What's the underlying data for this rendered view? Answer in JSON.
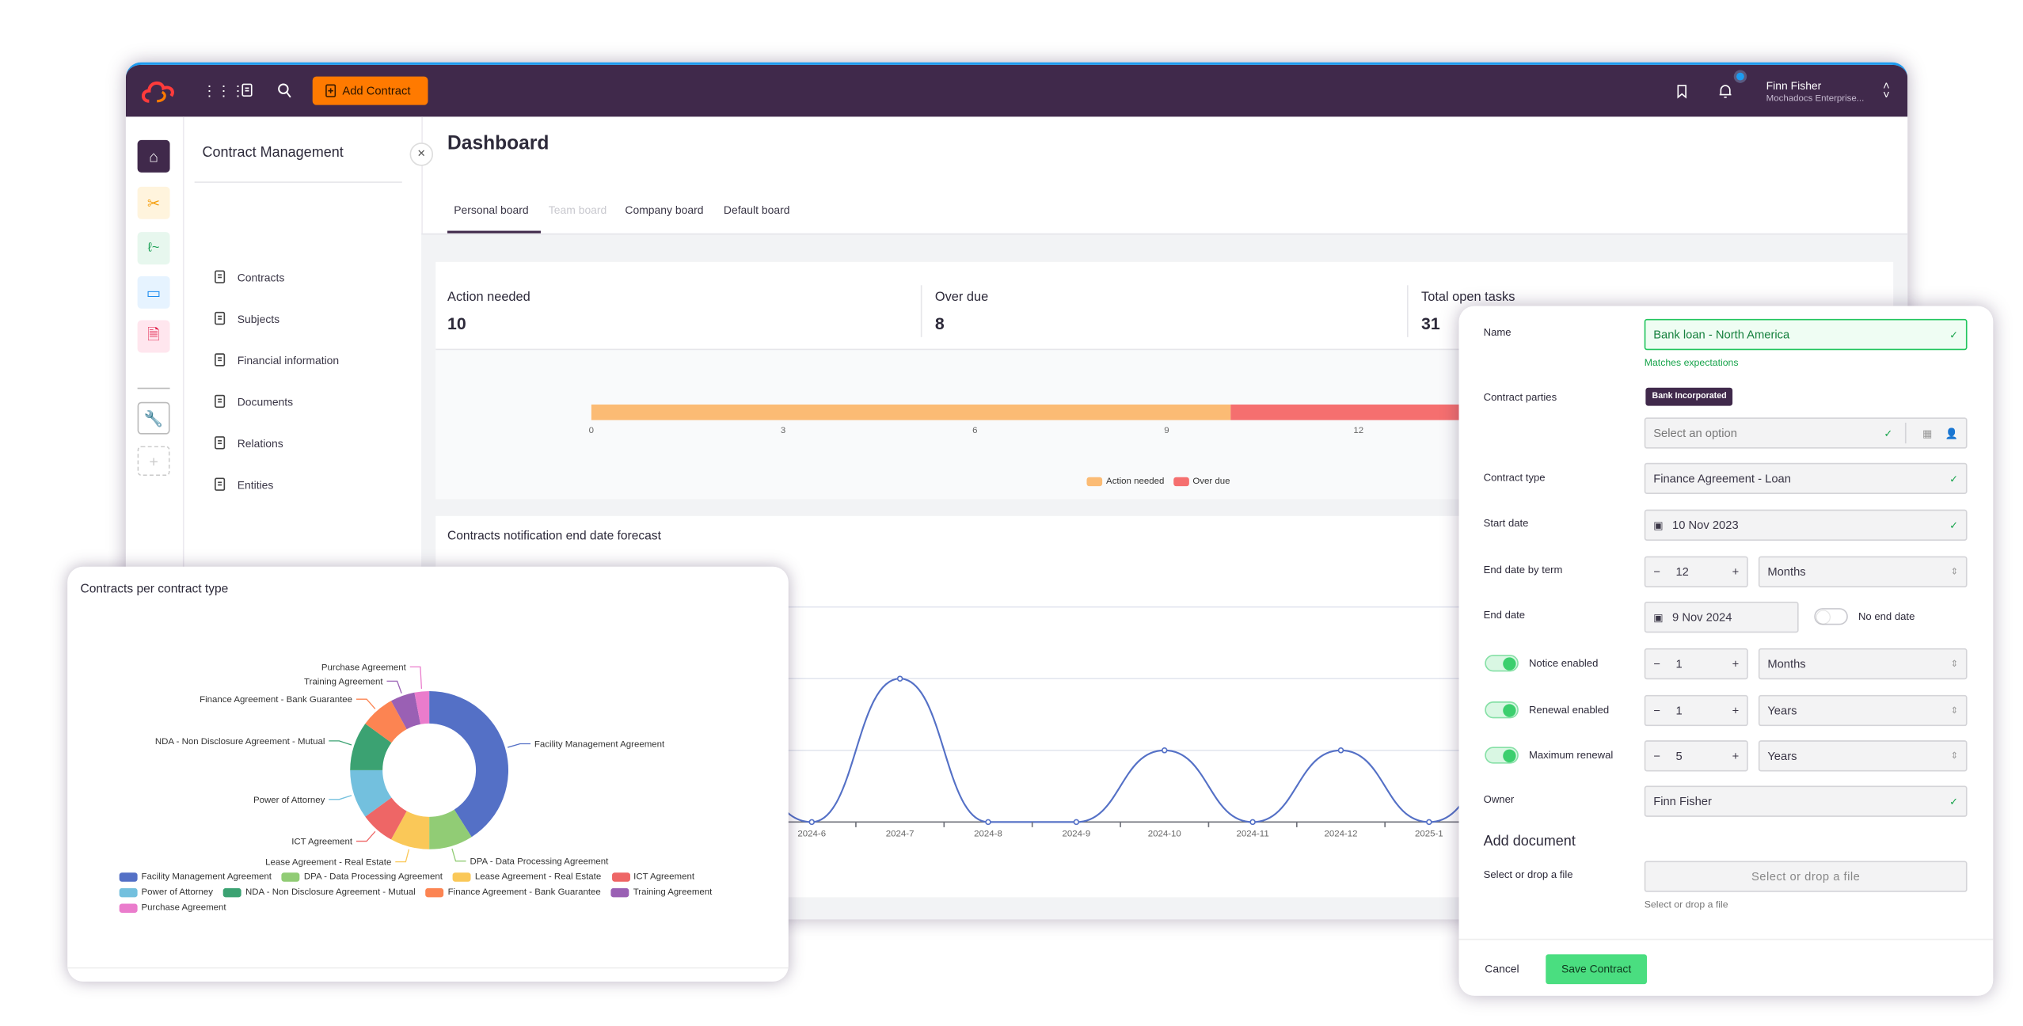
{
  "header": {
    "add_contract": "Add Contract",
    "user_name": "Finn Fisher",
    "user_org": "Mochadocs Enterprise...",
    "brand_color": "#40294b",
    "accent_color": "#ff7a00",
    "icons": [
      "logo-cloud-icon",
      "apps-grid-icon",
      "clipboard-icon",
      "search-icon",
      "bookmark-icon",
      "bell-icon",
      "chevron-updown-icon"
    ]
  },
  "rail": {
    "icons": [
      "home-icon",
      "tools-icon",
      "signature-icon",
      "folder-icon",
      "document-clock-icon",
      "wrench-icon",
      "plus-icon"
    ]
  },
  "sidebar": {
    "title": "Contract Management",
    "items": [
      {
        "label": "Contracts",
        "icon": "contract-icon"
      },
      {
        "label": "Subjects",
        "icon": "list-icon"
      },
      {
        "label": "Financial information",
        "icon": "dollar-icon"
      },
      {
        "label": "Documents",
        "icon": "documents-icon"
      },
      {
        "label": "Relations",
        "icon": "relations-icon"
      },
      {
        "label": "Entities",
        "icon": "building-icon"
      }
    ]
  },
  "main": {
    "title": "Dashboard",
    "tabs": [
      {
        "label": "Personal board",
        "active": true
      },
      {
        "label": "Team board",
        "disabled": true
      },
      {
        "label": "Company board"
      },
      {
        "label": "Default board"
      }
    ]
  },
  "kpis": [
    {
      "label": "Action needed",
      "value": "10"
    },
    {
      "label": "Over due",
      "value": "8"
    },
    {
      "label": "Total open tasks",
      "value": "31"
    }
  ],
  "chart_data": [
    {
      "type": "bar",
      "orientation": "horizontal",
      "stacked": true,
      "series": [
        {
          "name": "Action needed",
          "values": [
            10
          ],
          "color": "#fbbb74"
        },
        {
          "name": "Over due",
          "values": [
            8
          ],
          "color": "#f56f6f"
        }
      ],
      "x_ticks": [
        "0",
        "3",
        "6",
        "9",
        "12"
      ],
      "xlim": [
        0,
        18
      ],
      "legend": "bottom"
    },
    {
      "type": "line",
      "title": "Contracts notification end date forecast",
      "x": [
        "2024-6",
        "2024-7",
        "2024-8",
        "2024-9",
        "2024-10",
        "2024-11",
        "2024-12",
        "2025-1"
      ],
      "series": [
        {
          "values": [
            0,
            2,
            0,
            0,
            1,
            0,
            1,
            0
          ],
          "color": "#5470c6"
        }
      ],
      "ylim": [
        0,
        3
      ],
      "grid": true,
      "smooth": true
    },
    {
      "type": "pie",
      "donut": true,
      "title": "Contracts per contract type",
      "legend": "bottom",
      "unit": "percent",
      "slices": [
        {
          "name": "Facility Management Agreement",
          "value": 41,
          "color": "#5470c6"
        },
        {
          "name": "DPA - Data Processing Agreement",
          "value": 9,
          "color": "#91cc75"
        },
        {
          "name": "Lease Agreement - Real Estate",
          "value": 8,
          "color": "#fac858"
        },
        {
          "name": "ICT Agreement",
          "value": 7,
          "color": "#ee6666"
        },
        {
          "name": "Power of Attorney",
          "value": 10,
          "color": "#73c0de"
        },
        {
          "name": "NDA - Non Disclosure Agreement - Mutual",
          "value": 10,
          "color": "#3ba272"
        },
        {
          "name": "Finance Agreement - Bank Guarantee",
          "value": 7,
          "color": "#fc8452"
        },
        {
          "name": "Training Agreement",
          "value": 5,
          "color": "#9a60b4"
        },
        {
          "name": "Purchase Agreement",
          "value": 3,
          "color": "#ea7ccc"
        }
      ]
    }
  ],
  "form": {
    "name_label": "Name",
    "name_value": "Bank loan - North America",
    "name_hint": "Matches expectations",
    "parties_label": "Contract parties",
    "party_chip": "Bank Incorporated",
    "parties_placeholder": "Select an option",
    "type_label": "Contract type",
    "type_value": "Finance Agreement - Loan",
    "start_label": "Start date",
    "start_value": "10 Nov 2023",
    "term_label": "End date by term",
    "term_value": "12",
    "term_unit": "Months",
    "end_label": "End date",
    "end_value": "9 Nov 2024",
    "no_end_label": "No end date",
    "no_end_on": false,
    "notice_label": "Notice enabled",
    "notice_on": true,
    "notice_value": "1",
    "notice_unit": "Months",
    "renewal_label": "Renewal enabled",
    "renewal_on": true,
    "renewal_value": "1",
    "renewal_unit": "Years",
    "max_label": "Maximum renewal",
    "max_on": true,
    "max_value": "5",
    "max_unit": "Years",
    "owner_label": "Owner",
    "owner_value": "Finn Fisher",
    "doc_heading": "Add document",
    "file_label": "Select or drop a file",
    "file_button": "Select or drop a file",
    "file_help": "Select or drop a file",
    "cancel": "Cancel",
    "save": "Save Contract",
    "minus": "−",
    "plus": "+"
  }
}
